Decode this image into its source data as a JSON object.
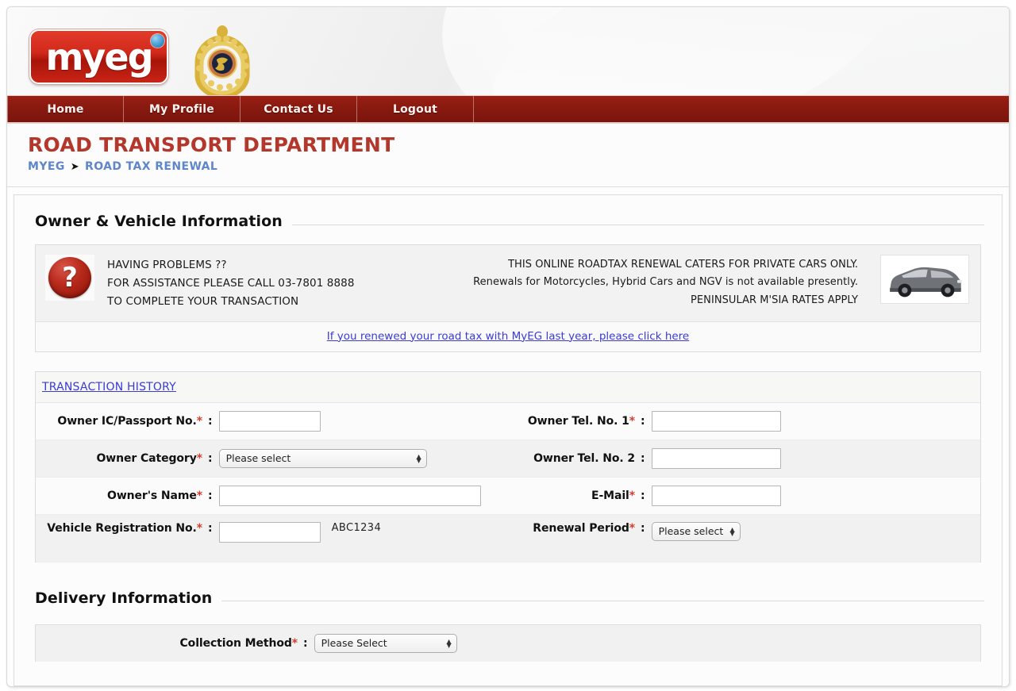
{
  "brand": {
    "logo_text": "myeg",
    "crest_name": "jpj-crest"
  },
  "nav": {
    "items": [
      {
        "label": "Home",
        "name": "nav-home"
      },
      {
        "label": "My Profile",
        "name": "nav-my-profile"
      },
      {
        "label": "Contact Us",
        "name": "nav-contact-us"
      },
      {
        "label": "Logout",
        "name": "nav-logout"
      }
    ]
  },
  "header": {
    "department_title": "ROAD TRANSPORT DEPARTMENT",
    "breadcrumb": {
      "root": "MYEG",
      "separator": "➤",
      "current": "ROAD TAX RENEWAL"
    }
  },
  "sections": {
    "owner_vehicle": "Owner & Vehicle Information",
    "delivery": "Delivery Information"
  },
  "notice": {
    "icon": "question-mark-icon",
    "left_lines": [
      "HAVING PROBLEMS ??",
      "FOR ASSISTANCE PLEASE CALL 03-7801 8888",
      "TO COMPLETE YOUR TRANSACTION"
    ],
    "right_lines": [
      "THIS ONLINE ROADTAX RENEWAL CATERS FOR PRIVATE CARS ONLY.",
      "Renewals for Motorcycles, Hybrid Cars and NGV is not available presently.",
      "PENINSULAR M'SIA RATES APPLY"
    ],
    "car_image_name": "car-photo",
    "link": "If you renewed your road tax with MyEG last year, please click here"
  },
  "form": {
    "transaction_history_link": "TRANSACTION HISTORY",
    "required_marker": "*",
    "colon": ":",
    "fields": {
      "owner_ic": {
        "label": "Owner IC/Passport No.",
        "value": "",
        "placeholder": ""
      },
      "owner_tel1": {
        "label": "Owner Tel. No. 1",
        "value": "",
        "placeholder": ""
      },
      "owner_category": {
        "label": "Owner Category",
        "selected": "Please select"
      },
      "owner_tel2": {
        "label": "Owner Tel. No. 2",
        "value": "",
        "placeholder": ""
      },
      "owner_name": {
        "label": "Owner's Name",
        "value": "",
        "placeholder": ""
      },
      "email": {
        "label": "E-Mail",
        "value": "",
        "placeholder": ""
      },
      "vehicle_reg": {
        "label": "Vehicle Registration No.",
        "value": "",
        "hint": "ABC1234"
      },
      "renewal_period": {
        "label": "Renewal Period",
        "selected": "Please select"
      },
      "collection_method": {
        "label": "Collection Method",
        "selected": "Please Select"
      }
    }
  },
  "colors": {
    "brand_red": "#8a1a10",
    "title_red": "#b4372b",
    "required_red": "#d83c2e",
    "link_blue": "#3b3bd6",
    "breadcrumb_blue": "#5f86c9"
  }
}
